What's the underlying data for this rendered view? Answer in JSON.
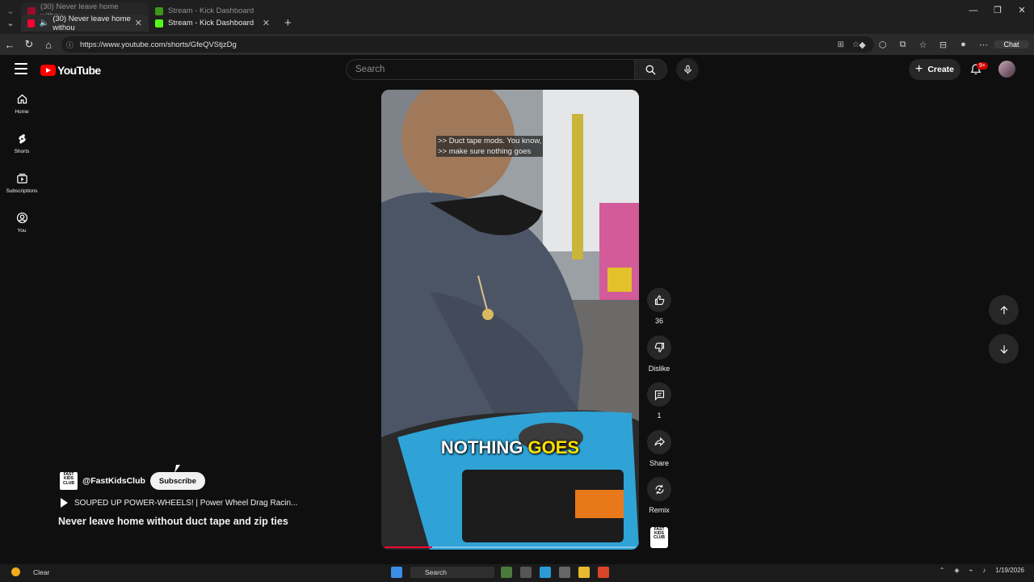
{
  "browser": {
    "tabs": [
      {
        "title": "(30) Never leave home withou",
        "favicon_color": "#ff0033",
        "muted": false,
        "active": true
      },
      {
        "title": "Stream - Kick Dashboard",
        "favicon_color": "#53fc18",
        "active": false
      }
    ],
    "url": "https://www.youtube.com/shorts/GfeQVStjzDg",
    "chat_label": "Chat"
  },
  "youtube": {
    "logo_text": "YouTube",
    "search_placeholder": "Search",
    "create_label": "Create",
    "notification_badge": "9+",
    "sidebar": [
      {
        "label": "Home",
        "icon": "home-icon"
      },
      {
        "label": "Shorts",
        "icon": "shorts-icon"
      },
      {
        "label": "Subscriptions",
        "icon": "subscriptions-icon"
      },
      {
        "label": "You",
        "icon": "you-icon"
      }
    ]
  },
  "video": {
    "caption_line1": ">> Duct tape mods. You know,",
    "caption_line2": ">> make sure nothing goes",
    "overlay_word1": "NOTHING",
    "overlay_word2": "GOES",
    "progress_fraction": 0.19
  },
  "actions": {
    "like_count": "36",
    "dislike_label": "Dislike",
    "comments_count": "1",
    "share_label": "Share",
    "remix_label": "Remix"
  },
  "channel": {
    "logo_text": "FAST KIDS CLUB",
    "handle": "@FastKidsClub",
    "subscribe_label": "Subscribe",
    "playlist_title": "SOUPED UP POWER-WHEELS! | Power Wheel Drag Racin...",
    "video_title": "Never leave home without duct tape and zip ties"
  },
  "taskbar": {
    "weather": "Clear",
    "search": "Search",
    "date": "1/19/2026"
  }
}
